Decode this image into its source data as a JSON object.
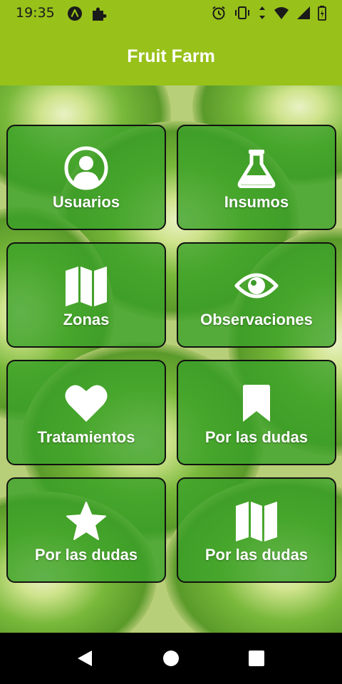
{
  "status_bar": {
    "time": "19:35",
    "left_icons": [
      "accessibility-a-icon",
      "puzzle-icon"
    ],
    "right_icons": [
      "alarm-icon",
      "vibrate-icon",
      "data-arrows-icon",
      "wifi-icon",
      "signal-icon",
      "battery-icon"
    ]
  },
  "app_bar": {
    "title": "Fruit Farm",
    "color": "#98c11a"
  },
  "menu": {
    "tiles": [
      {
        "label": "Usuarios",
        "icon": "user-circle-icon"
      },
      {
        "label": "Insumos",
        "icon": "flask-icon"
      },
      {
        "label": "Zonas",
        "icon": "map-icon"
      },
      {
        "label": "Observaciones",
        "icon": "eye-icon"
      },
      {
        "label": "Tratamientos",
        "icon": "heart-icon"
      },
      {
        "label": "Por las dudas",
        "icon": "bookmark-icon"
      },
      {
        "label": "Por las dudas",
        "icon": "star-icon"
      },
      {
        "label": "Por las dudas",
        "icon": "map-icon"
      }
    ]
  },
  "nav_bar": {
    "buttons": [
      "back",
      "home",
      "recents"
    ]
  }
}
